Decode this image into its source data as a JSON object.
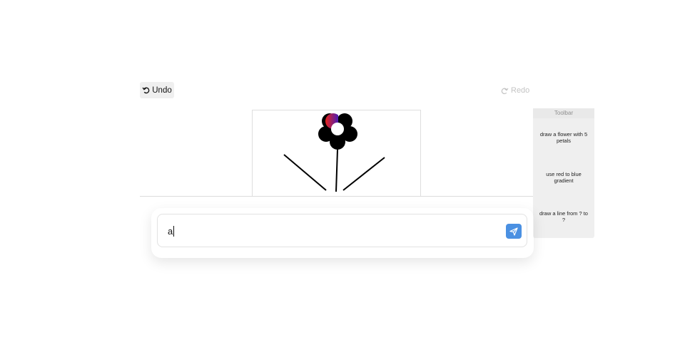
{
  "history": {
    "undo_label": "Undo",
    "redo_label": "Redo",
    "undo_icon": "undo-arrow-icon",
    "redo_icon": "redo-arrow-icon"
  },
  "toolbar": {
    "title": "Toolbar",
    "items": [
      {
        "label": "draw a flower with 5 petals"
      },
      {
        "label": "use red to blue gradient"
      },
      {
        "label": "draw a line from ? to ?"
      }
    ]
  },
  "chat": {
    "input_value": "a",
    "send_icon": "paper-plane-icon"
  },
  "colors": {
    "accent": "#4a90e2",
    "flower": "#000000",
    "gradient_start": "#e8231a",
    "gradient_end": "#2a1ad6",
    "panel_bg": "#efefef",
    "disabled_text": "#c4c4c4"
  }
}
